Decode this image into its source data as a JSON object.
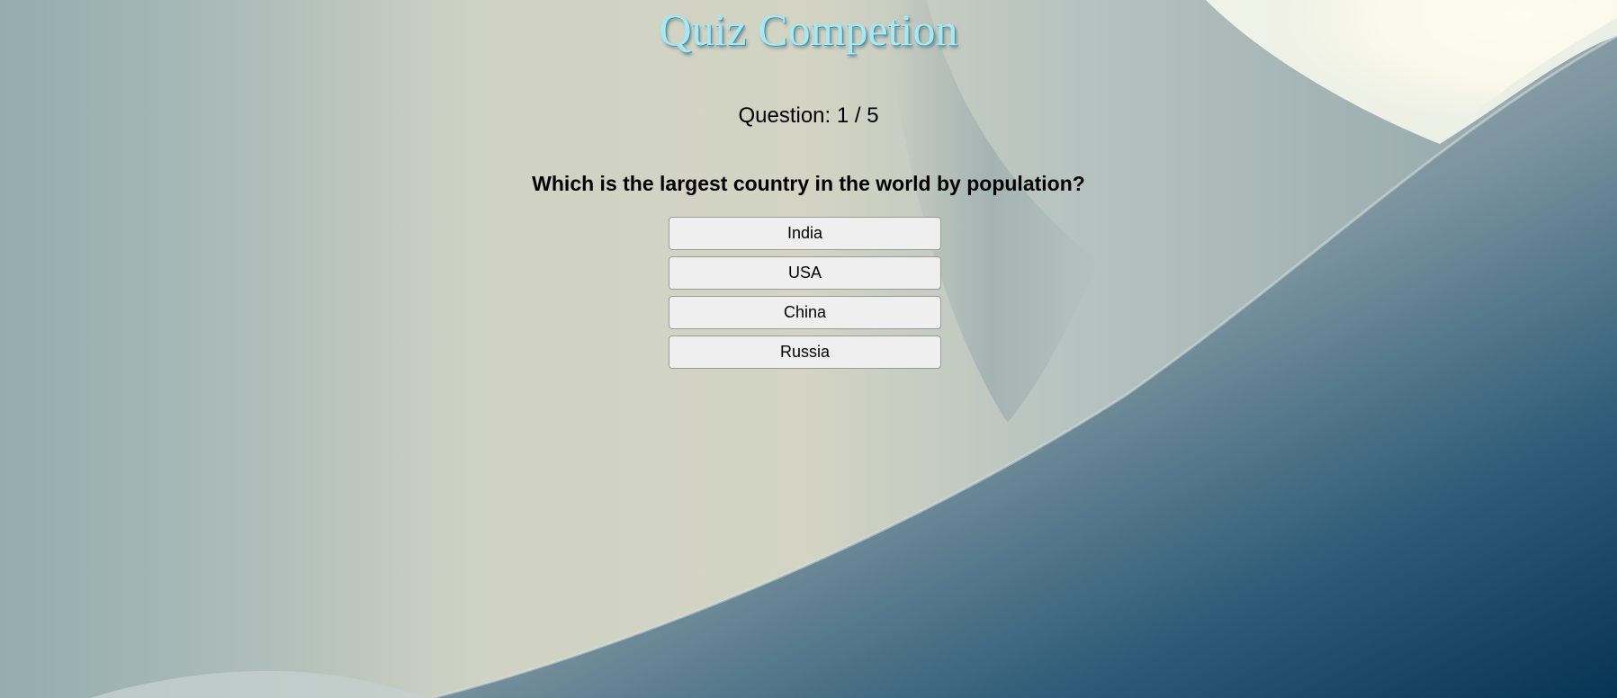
{
  "quiz": {
    "title": "Quiz Competion",
    "counter": "Question: 1 / 5",
    "question": "Which is the largest country in the world by population?",
    "answers": [
      "India",
      "USA",
      "China",
      "Russia"
    ]
  },
  "colors": {
    "title_text": "#a6e9f3",
    "button_background": "#efefef",
    "button_border": "#9a9a9a",
    "background_light": "#f6f7e6",
    "background_dark": "#073a5a"
  }
}
